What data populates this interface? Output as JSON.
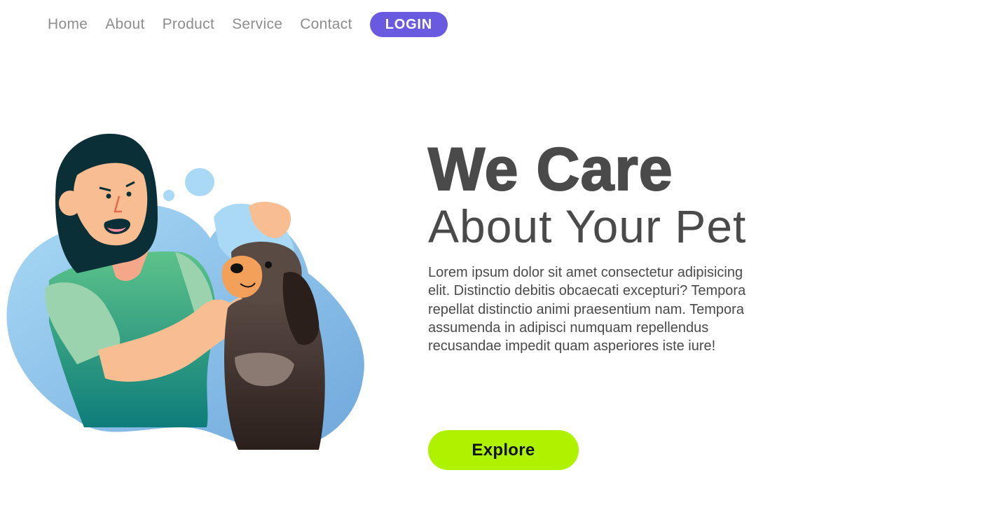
{
  "nav": {
    "items": [
      {
        "label": "Home"
      },
      {
        "label": "About"
      },
      {
        "label": "Product"
      },
      {
        "label": "Service"
      },
      {
        "label": "Contact"
      }
    ],
    "login_label": "LOGIN"
  },
  "hero": {
    "title_bold": "We Care",
    "title_light": "About Your Pet",
    "description": "Lorem ipsum dolor sit amet consectetur adipisicing elit. Distinctio debitis obcaecati excepturi? Tempora repellat distinctio animi praesentium nam. Tempora assumenda in adipisci numquam repellendus recusandae impedit quam asperiores iste iure!",
    "cta_label": "Explore",
    "illustration": "woman-giving-ear-drops-to-dog-illustration"
  },
  "colors": {
    "accent_purple": "#6a5ae0",
    "cta_green": "#aef200",
    "text_dark": "#4a4a4a",
    "nav_gray": "#8d8d8d",
    "blob_blue": "#8ec8ee"
  }
}
